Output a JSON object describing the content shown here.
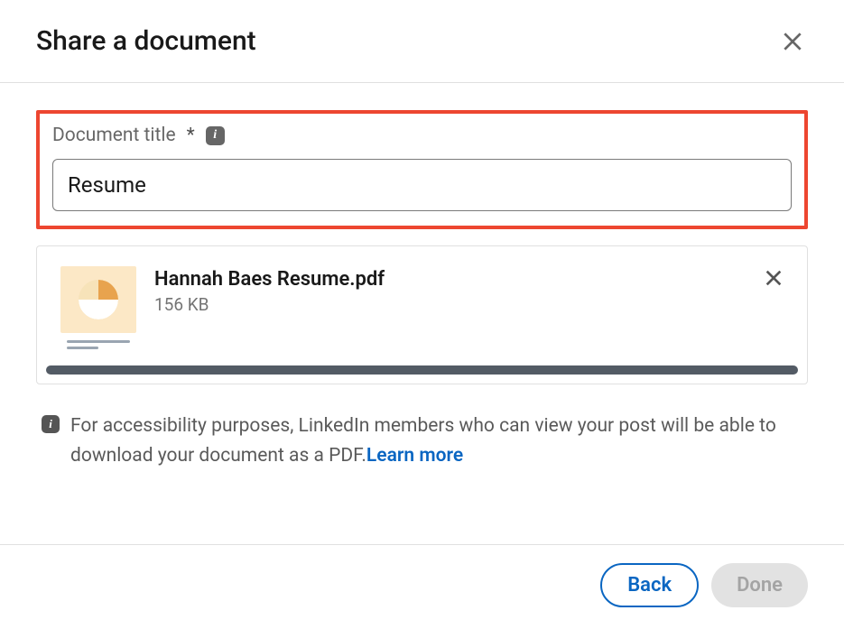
{
  "header": {
    "title": "Share a document"
  },
  "form": {
    "title_label": "Document title",
    "required_mark": "*",
    "title_value": "Resume"
  },
  "file": {
    "name": "Hannah Baes Resume.pdf",
    "size": "156 KB"
  },
  "note": {
    "text": "For accessibility purposes, LinkedIn members who can view your post will be able to download your document as a PDF.",
    "learn_more": "Learn more"
  },
  "footer": {
    "back": "Back",
    "done": "Done"
  }
}
